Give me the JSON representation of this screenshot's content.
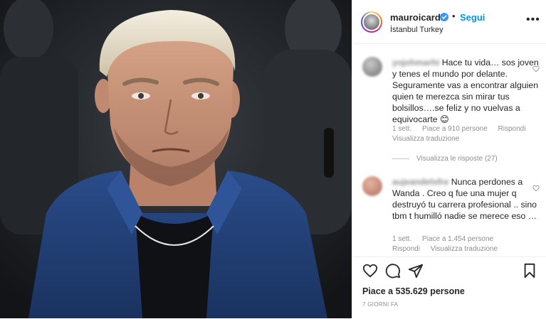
{
  "post": {
    "username": "mauroicardi",
    "follow_label": "Segui",
    "separator": "•",
    "location": "İstanbul Turkey",
    "more_label": "•••",
    "likes_text": "Piace a 535.629 persone",
    "date_text": "7 GIORNI FA"
  },
  "comments": [
    {
      "author": "yojohmarhi",
      "text": "Hace tu vida… sos joven y tenes el mundo por delante. Seguramente vas a encontrar alguien quien te merezca sin mirar tus bolsillos….se feliz y no vuelvas a equivocarte 😊",
      "time": "1 sett.",
      "likes": "Piace a 910 persone",
      "reply_label": "Rispondi",
      "translate_label": "Visualizza traduzione"
    },
    {
      "author": "aujeandelsfre",
      "text": "Nunca perdones a Wanda . Creo q fue una mujer q destruyó tu carrera profesional .. sino tbm t humilló nadie se merece eso …",
      "time": "1 sett.",
      "likes": "Piace a 1.454 persone",
      "reply_label": "Rispondi",
      "translate_label": "Visualizza traduzione"
    }
  ],
  "view_replies_label": "Visualizza le risposte (27)",
  "icons": {
    "verified": "verified-badge-icon",
    "like": "heart-icon",
    "comment": "comment-bubble-icon",
    "share": "paper-plane-icon",
    "save": "bookmark-icon"
  },
  "colors": {
    "accent": "#0095f6",
    "text": "#262626",
    "muted": "#8e8e8e",
    "jacket": "#1f3a6e"
  }
}
